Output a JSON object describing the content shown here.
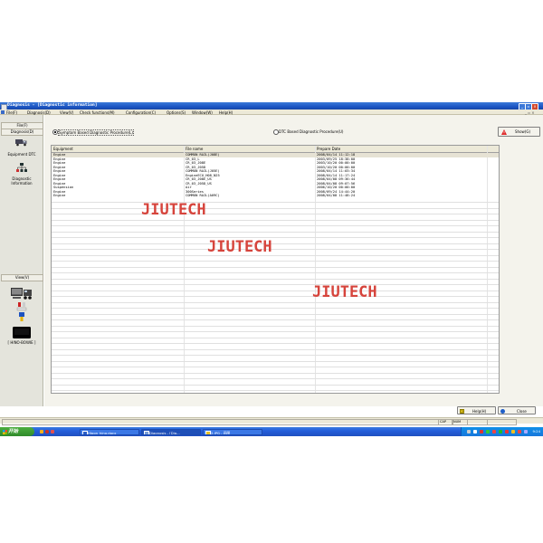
{
  "window": {
    "title": "Diagnosis - [Diagnostic information]"
  },
  "menubar": {
    "items": [
      "File(F)",
      "Diagnosis(D)",
      "View(V)",
      "Check functions(M)",
      "Configuration(C)",
      "Options(S)",
      "Window(W)",
      "Help(H)"
    ],
    "mdi_controls": "_ ▫ ×"
  },
  "leftnav": {
    "file": "File(F)",
    "diagnosis": "Diagnosis(D)",
    "items": [
      {
        "label": "Equipment DTC",
        "icon": "truck-icon"
      },
      {
        "label": "Diagnostic\nInformation",
        "icon": "network-icon"
      }
    ],
    "view": "View(V)",
    "device_label": "[ HINO-BOWIE ]"
  },
  "main": {
    "radio_symptom": "Symptom Based Diagnostic Procedure(L)",
    "radio_dtc": "DTC Based Diagnostic Procedure(U)",
    "show_button": "Show(G)",
    "table": {
      "headers": [
        "Equipment",
        "File name",
        "Prepare Date"
      ],
      "rows": [
        [
          "Engine",
          "COMMON RAIL(J08E)",
          "2008/04/14 11:12:18"
        ],
        [
          "Engine",
          "CR_03_L",
          "2003/09/25 18:38:00"
        ],
        [
          "Engine",
          "CR_03_J08E",
          "2003/10/20 00:00:00"
        ],
        [
          "Engine",
          "CR_03_J05D",
          "2003/10/20 00:00:00"
        ],
        [
          "Engine",
          "COMMON RAIL(J05E)",
          "2008/04/14 11:03:34"
        ],
        [
          "Engine",
          "EngineECU_H08_N25",
          "2008/04/14 11:17:24"
        ],
        [
          "Engine",
          "CR_03_J08E_US",
          "2008/04/08 09:36:44"
        ],
        [
          "Engine",
          "CR_03_J05D_US",
          "2008/04/08 09:07:56"
        ],
        [
          "Suspension",
          "Air",
          "2006/10/20 00:00:00"
        ],
        [
          "Engine",
          "300Series",
          "2008/09/24 14:44:20"
        ],
        [
          "Engine",
          "COMMON RAIL(A09C)",
          "2008/04/08 11:48:24"
        ]
      ]
    },
    "watermark": "JIUTECH",
    "help_button": "Help(H)",
    "close_button": "Close"
  },
  "statusbar": {
    "caps": "CAP",
    "num": "NUM"
  },
  "taskbar": {
    "start": "开始",
    "tasks": [
      "Hlpon_hino.docx",
      "Diagnosis - [Dia...",
      "2.JPG - 画图"
    ],
    "clock": "9:24"
  },
  "colors": {
    "titlebar": "#1c56c4",
    "watermark": "#d6443c",
    "taskbar": "#245edb",
    "start": "#3a9a32"
  }
}
